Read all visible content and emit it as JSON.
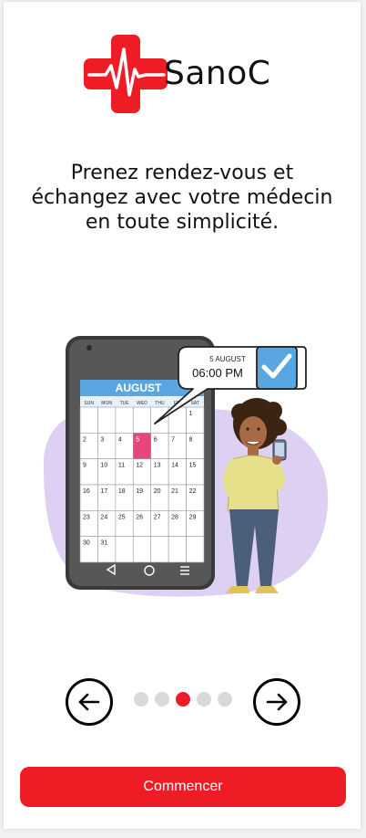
{
  "brand": {
    "name": "SanoC",
    "color": "#ee1c25"
  },
  "headline": "Prenez rendez-vous et échangez avec votre médecin en toute simplicité.",
  "illustration": {
    "calendar": {
      "month": "AUGUST",
      "weekdays": [
        "SUN",
        "MON",
        "TUE",
        "WED",
        "THU",
        "FRI",
        "SAT"
      ],
      "rows": [
        [
          "",
          "",
          "",
          "",
          "",
          "",
          "1"
        ],
        [
          "2",
          "3",
          "4",
          "5",
          "6",
          "7",
          "8"
        ],
        [
          "9",
          "10",
          "11",
          "12",
          "13",
          "14",
          "15"
        ],
        [
          "16",
          "17",
          "18",
          "19",
          "20",
          "21",
          "22"
        ],
        [
          "23",
          "24",
          "25",
          "26",
          "27",
          "28",
          "29"
        ],
        [
          "30",
          "31",
          "",
          "",
          "",
          "",
          ""
        ]
      ],
      "highlighted_day": "5"
    },
    "bubble": {
      "date": "5 AUGUST",
      "time": "06:00 PM"
    }
  },
  "pagination": {
    "total": 5,
    "active_index": 2
  },
  "cta_label": "Commencer"
}
